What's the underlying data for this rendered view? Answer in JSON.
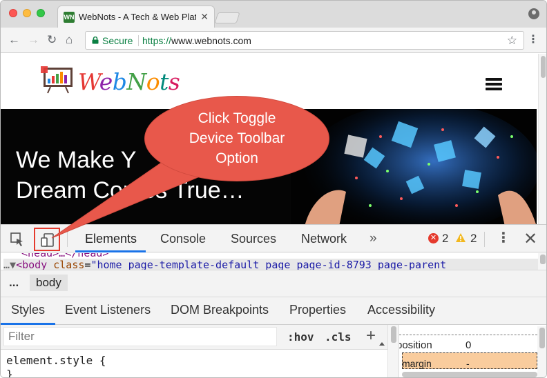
{
  "browser": {
    "tab_title": "WebNots - A Tech & Web Platf",
    "tab_favicon_text": "WN",
    "secure_label": "Secure",
    "url_scheme": "https://",
    "url_host": "www.webnots.com"
  },
  "page": {
    "logo_text": "WebNots",
    "logo_colors": [
      "#e53935",
      "#8e24aa",
      "#1e88e5",
      "#43a047",
      "#fb8c00",
      "#00897b",
      "#d81b60"
    ],
    "hero_line1": "We Make Y",
    "hero_line2": "Dream Comes True…"
  },
  "callout": {
    "line1": "Click Toggle",
    "line2": "Device Toolbar",
    "line3": "Option",
    "color": "#e8584b"
  },
  "devtools": {
    "tabs": [
      "Elements",
      "Console",
      "Sources",
      "Network"
    ],
    "more": "»",
    "error_count": "2",
    "warning_count": "2",
    "dom_row1": "<head>…</head>",
    "dom_tag": "<body",
    "dom_attr": "class",
    "dom_val": "\"home page-template-default page page-id-8793 page-parent",
    "crumb_more": "...",
    "crumb_body": "body",
    "subtabs": [
      "Styles",
      "Event Listeners",
      "DOM Breakpoints",
      "Properties",
      "Accessibility"
    ],
    "filter_placeholder": "Filter",
    "hov": ":hov",
    "cls": ".cls",
    "plus": "+",
    "rule_selector": "element.style {",
    "rule_close": "}",
    "bm_position_label": "position",
    "bm_position_value": "0",
    "bm_margin_label": "margin",
    "bm_margin_value": "-",
    "accent": "#1a73e8"
  }
}
